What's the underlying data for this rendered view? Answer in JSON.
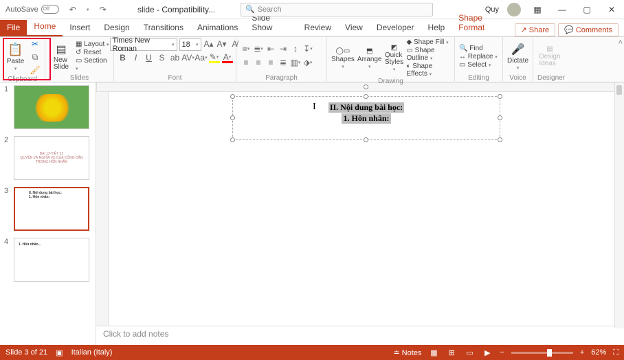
{
  "titlebar": {
    "autosave": "AutoSave",
    "autosave_state": "Off",
    "doc_title": "slide  -  Compatibility...",
    "search_placeholder": "Search",
    "user": "Quy",
    "ribbon_opts": "▦"
  },
  "tabs": {
    "file": "File",
    "home": "Home",
    "insert": "Insert",
    "design": "Design",
    "transitions": "Transitions",
    "animations": "Animations",
    "slideshow": "Slide Show",
    "review": "Review",
    "view": "View",
    "developer": "Developer",
    "help": "Help",
    "shape_format": "Shape Format",
    "share": "Share",
    "comments": "Comments"
  },
  "ribbon": {
    "clipboard": {
      "paste": "Paste",
      "label": "Clipboard"
    },
    "slides": {
      "new_slide": "New\nSlide",
      "layout": "Layout",
      "reset": "Reset",
      "section": "Section",
      "label": "Slides"
    },
    "font": {
      "name": "Times New Roman",
      "size": "18",
      "label": "Font"
    },
    "paragraph": {
      "label": "Paragraph"
    },
    "drawing": {
      "shapes": "Shapes",
      "arrange": "Arrange",
      "quick_styles": "Quick\nStyles",
      "fill": "Shape Fill",
      "outline": "Shape Outline",
      "effects": "Shape Effects",
      "label": "Drawing"
    },
    "editing": {
      "find": "Find",
      "replace": "Replace",
      "select": "Select",
      "label": "Editing"
    },
    "voice": {
      "dictate": "Dictate",
      "label": "Voice"
    },
    "designer": {
      "ideas": "Design\nIdeas",
      "label": "Designer"
    }
  },
  "thumbnails": [
    {
      "num": "1"
    },
    {
      "num": "2",
      "text": "BÀI 12-TIẾT 21\nQUYỀN VÀ NGHĨA VỤ CỦA CÔNG DÂN\nTRONG HÔN NHÂN"
    },
    {
      "num": "3",
      "text": "II. Nội dung bài học:\n1. Hôn nhân:"
    },
    {
      "num": "4",
      "text": "1. Hôn nhân..."
    }
  ],
  "canvas": {
    "line1": "II. Nội dung bài học:",
    "line2": "1. Hôn nhân:"
  },
  "notes": {
    "placeholder": "Click to add notes"
  },
  "status": {
    "slide_of": "Slide 3 of 21",
    "lang": "Italian (Italy)",
    "notes": "Notes",
    "zoom": "62%"
  }
}
